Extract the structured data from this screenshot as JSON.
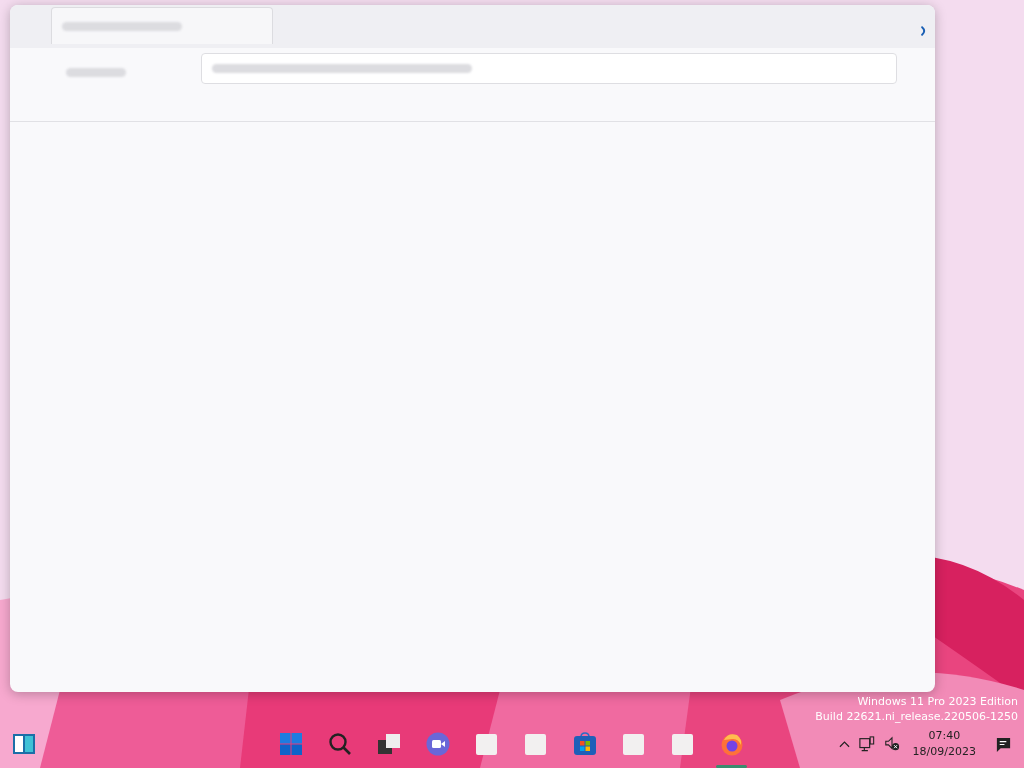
{
  "desktop": {
    "edition_lines": [
      "Windows 11 Pro 2023 Edition",
      "Build 22621.ni_release.220506-1250"
    ]
  },
  "window": {
    "loading": true
  },
  "taskbar": {
    "apps": [
      {
        "kind": "start",
        "active": false
      },
      {
        "kind": "search",
        "active": false
      },
      {
        "kind": "task-view",
        "active": false
      },
      {
        "kind": "video-chat",
        "active": false
      },
      {
        "kind": "app",
        "active": false
      },
      {
        "kind": "app",
        "active": false
      },
      {
        "kind": "store",
        "active": false
      },
      {
        "kind": "app",
        "active": false
      },
      {
        "kind": "app",
        "active": false
      },
      {
        "kind": "firefox",
        "active": true
      }
    ],
    "clock": {
      "time": "07:40",
      "date": "18/09/2023"
    }
  }
}
